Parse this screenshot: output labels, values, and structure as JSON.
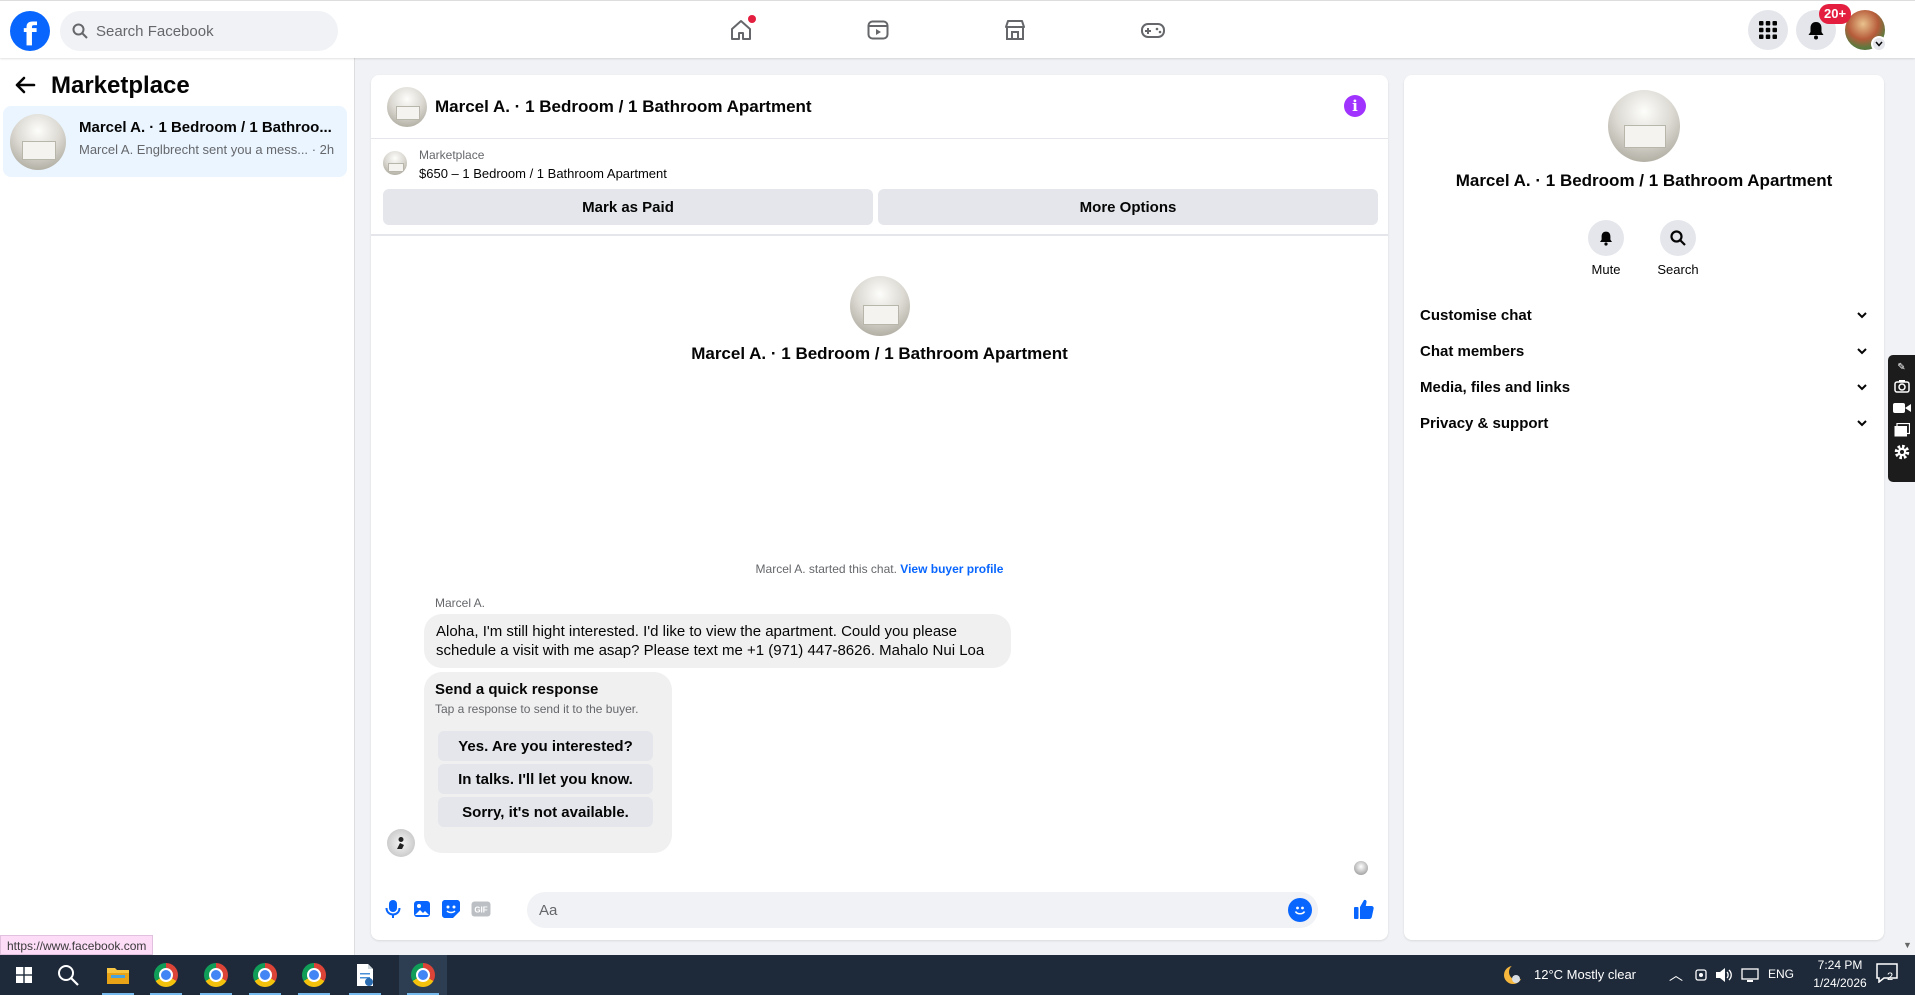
{
  "topbar": {
    "logo_letter": "f",
    "search_placeholder": "Search Facebook",
    "notification_count": "20+",
    "nav": [
      "home-icon",
      "video-icon",
      "marketplace-icon",
      "gaming-icon"
    ]
  },
  "left_panel": {
    "title": "Marketplace",
    "conversation": {
      "title": "Marcel A. · 1 Bedroom / 1 Bathroo...",
      "preview": "Marcel A. Englbrecht sent you a mess...",
      "time": "· 2h"
    }
  },
  "status_url": "https://www.facebook.com",
  "chat": {
    "header_title": "Marcel A. · 1 Bedroom / 1 Bathroom Apartment",
    "marketplace_label": "Marketplace",
    "listing": "$650 – 1 Bedroom / 1 Bathroom Apartment",
    "mark_paid": "Mark as Paid",
    "more_options": "More Options",
    "center_title": "Marcel A. · 1 Bedroom / 1 Bathroom Apartment",
    "started_text": "Marcel A. started this chat.",
    "view_profile": "View buyer profile",
    "sender": "Marcel A.",
    "message": "Aloha, I'm still hight interested. I'd like to view the apartment. Could you please schedule a visit with me asap? Please text me +1 (971) 447-8626. Mahalo Nui Loa",
    "quick": {
      "title": "Send a quick response",
      "subtitle": "Tap a response to send it to the buyer.",
      "options": [
        "Yes. Are you interested?",
        "In talks. I'll let you know.",
        "Sorry, it's not available."
      ]
    },
    "composer_placeholder": "Aa"
  },
  "right_panel": {
    "title": "Marcel A. · 1 Bedroom / 1 Bathroom Apartment",
    "mute": "Mute",
    "search": "Search",
    "sections": [
      "Customise chat",
      "Chat members",
      "Media, files and links",
      "Privacy & support"
    ]
  },
  "taskbar": {
    "weather": "12°C  Mostly clear",
    "lang": "ENG",
    "time": "7:24 PM",
    "date": "1/24/2026",
    "notif_count": "2"
  },
  "colors": {
    "brand": "#0866ff",
    "info": "#a033ff",
    "badge": "#e41e3f"
  }
}
